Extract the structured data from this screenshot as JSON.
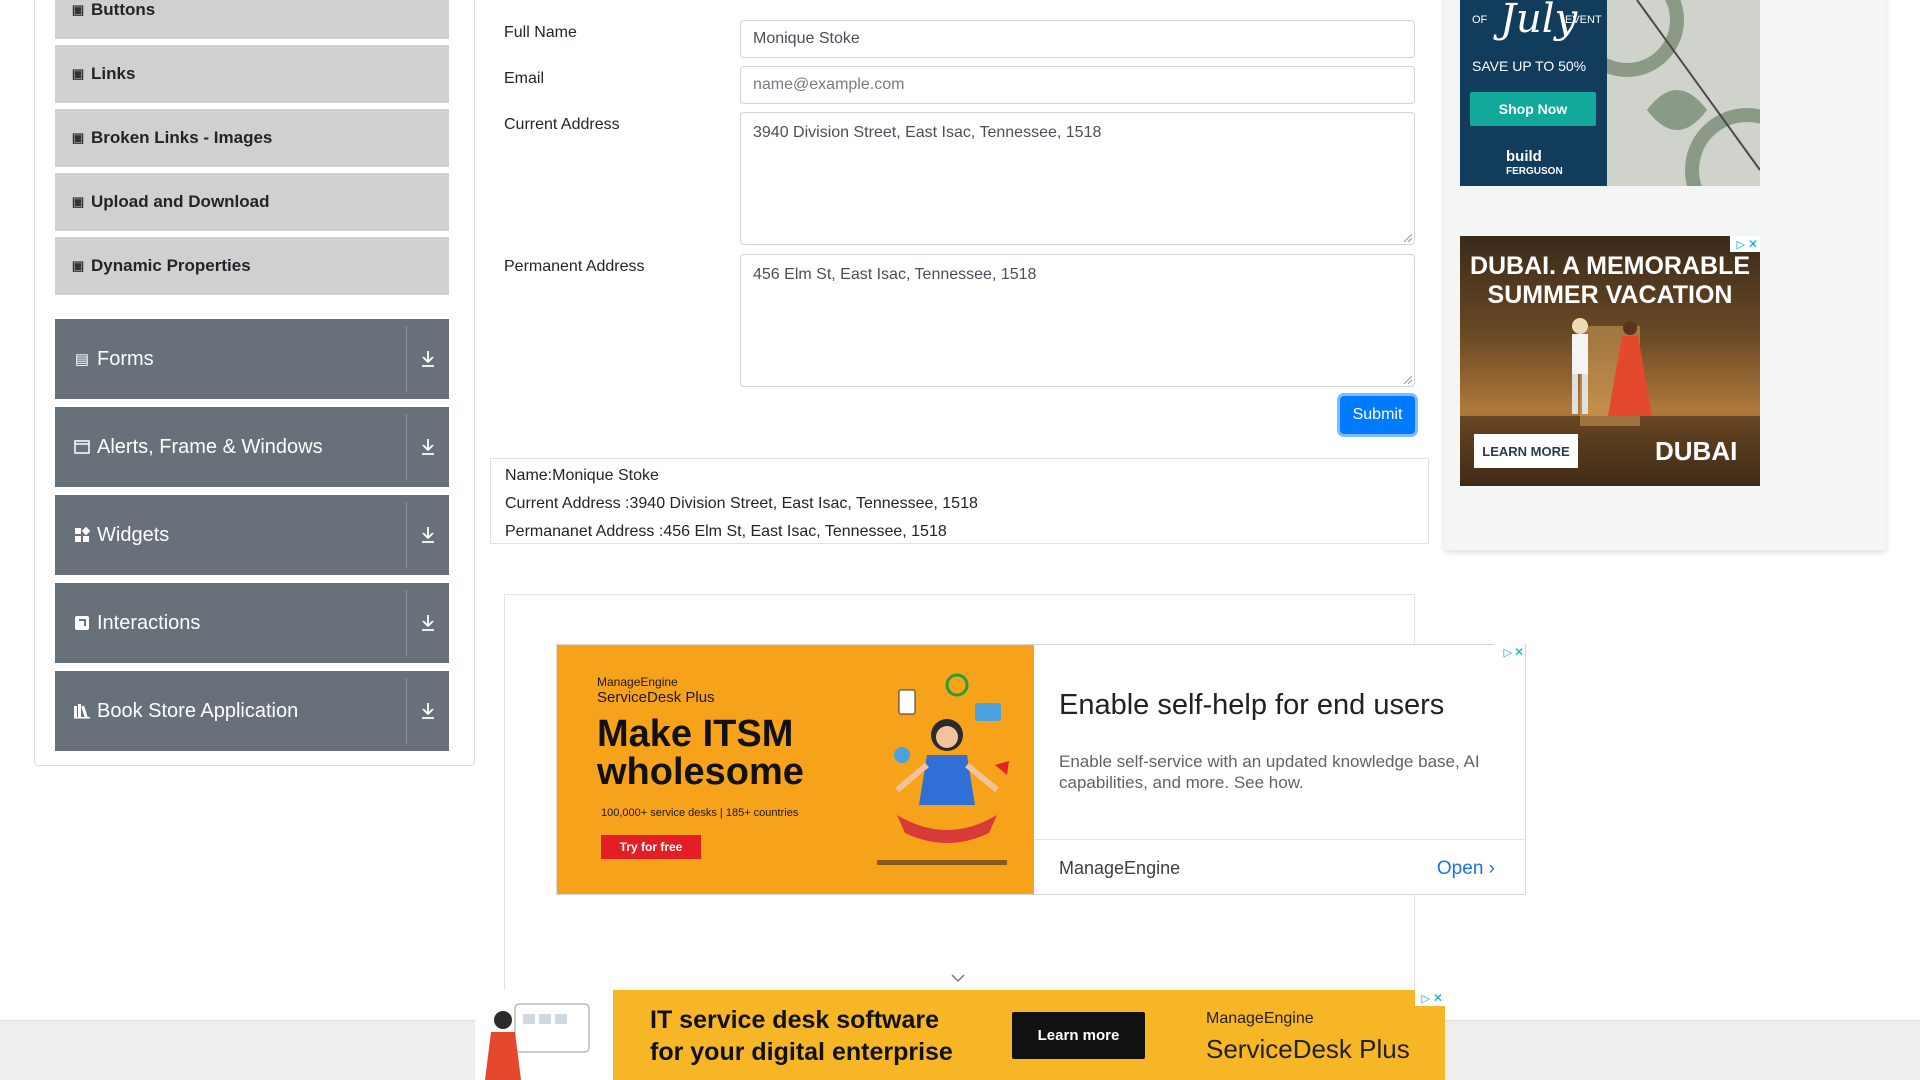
{
  "sidebar": {
    "sub_items": [
      {
        "label": "Buttons"
      },
      {
        "label": "Links"
      },
      {
        "label": "Broken Links - Images"
      },
      {
        "label": "Upload and Download"
      },
      {
        "label": "Dynamic Properties"
      }
    ],
    "groups": [
      {
        "label": "Forms",
        "icon": "form-icon"
      },
      {
        "label": "Alerts, Frame & Windows",
        "icon": "window-icon"
      },
      {
        "label": "Widgets",
        "icon": "widgets-icon"
      },
      {
        "label": "Interactions",
        "icon": "interactions-icon"
      },
      {
        "label": "Book Store Application",
        "icon": "book-icon"
      }
    ]
  },
  "form": {
    "full_name_label": "Full Name",
    "full_name_value": "Monique Stoke",
    "email_label": "Email",
    "email_placeholder": "name@example.com",
    "current_address_label": "Current Address",
    "current_address_value": "3940 Division Street, East Isac, Tennessee, 1518",
    "permanent_address_label": "Permanent Address",
    "permanent_address_value": "456 Elm St, East Isac, Tennessee, 1518",
    "submit_label": "Submit"
  },
  "output": {
    "name": "Name:Monique Stoke",
    "current_address": "Current Address :3940 Division Street, East Isac, Tennessee, 1518",
    "permanent_address": "Permananet Address :456 Elm St, East Isac, Tennessee, 1518"
  },
  "ads": {
    "top_right": {
      "script_word": "July",
      "of_word": "OF",
      "event_word": "EVENT",
      "save_text": "SAVE UP TO 50%",
      "button": "Shop Now",
      "logo_line1": "build",
      "logo_line2": "FERGUSON"
    },
    "dubai": {
      "headline1": "DUBAI. A MEMORABLE",
      "headline2": "SUMMER VACATION",
      "button": "LEARN MORE",
      "logo": "DUBAI"
    },
    "manageengine": {
      "brand": "ManageEngine",
      "product": "ServiceDesk Plus",
      "headline": "Make ITSM wholesome",
      "stats": "100,000+ service desks | 185+ countries",
      "try_button": "Try for free",
      "title": "Enable self-help for end users",
      "description": "Enable self-service with an updated knowledge base, AI capabilities, and more. See how.",
      "advertiser": "ManageEngine",
      "open_label": "Open"
    },
    "bottom": {
      "line1": "IT service desk software",
      "line2": "for your digital enterprise",
      "button": "Learn more",
      "brand": "ManageEngine",
      "product": "ServiceDesk Plus"
    }
  },
  "colors": {
    "accent": "#007bff",
    "sidebar_group": "#68707a",
    "sidebar_subitem": "#d0d0d0"
  }
}
